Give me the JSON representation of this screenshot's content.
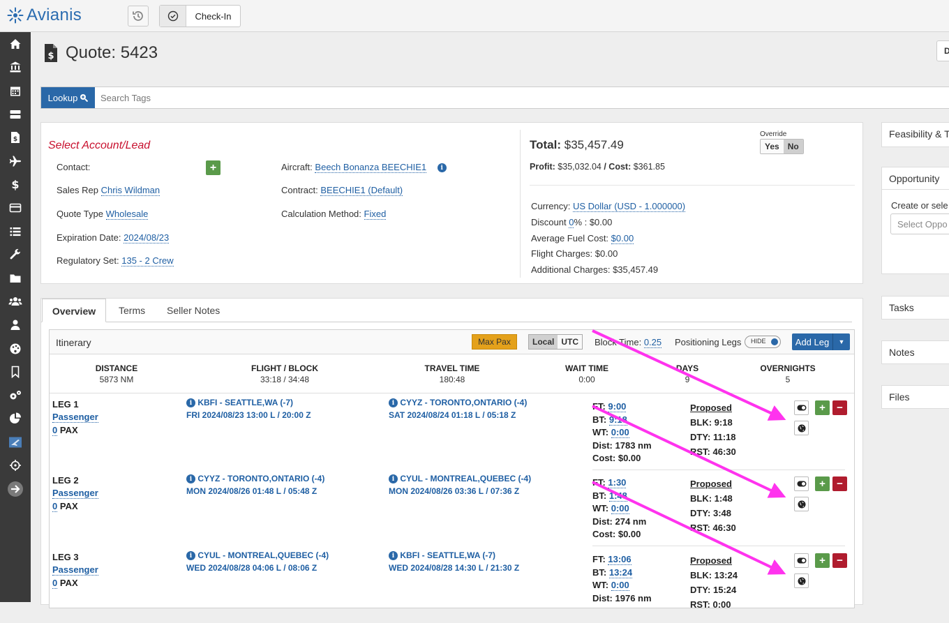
{
  "app": {
    "name": "Avianis",
    "checkin_label": "Check-In"
  },
  "page": {
    "title": "Quote: 5423",
    "top_right_btn": "D"
  },
  "lookup": {
    "button_label": "Lookup",
    "placeholder": "Search Tags"
  },
  "quote": {
    "select_account": "Select Account/Lead",
    "contact_label": "Contact:",
    "sales_rep_label": "Sales Rep",
    "sales_rep": "Chris Wildman",
    "quote_type_label": "Quote Type",
    "quote_type": "Wholesale",
    "expiration_label": "Expiration Date:",
    "expiration": "2024/08/23",
    "regulatory_label": "Regulatory Set:",
    "regulatory": "135 - 2 Crew",
    "aircraft_label": "Aircraft:",
    "aircraft": "Beech Bonanza BEECHIE1",
    "contract_label": "Contract:",
    "contract": "BEECHIE1 (Default)",
    "calc_label": "Calculation Method:",
    "calc": "Fixed"
  },
  "totals": {
    "total_label": "Total:",
    "total": "$35,457.49",
    "profit_label": "Profit:",
    "profit": "$35,032.04",
    "cost_label": "/ Cost:",
    "cost": "$361.85",
    "override_label": "Override",
    "override_yes": "Yes",
    "override_no": "No",
    "currency_label": "Currency:",
    "currency": "US Dollar (USD - 1.000000)",
    "discount_label": "Discount",
    "discount_pct": "0",
    "discount_rest": "% : $0.00",
    "fuel_label": "Average Fuel Cost:",
    "fuel": "$0.00",
    "flight_charges": "Flight Charges: $0.00",
    "additional_charges": "Additional Charges: $35,457.49"
  },
  "side_panels": {
    "feasibility": "Feasibility & T",
    "opportunity": "Opportunity",
    "opportunity_create": "Create or sele",
    "opportunity_placeholder": "Select Oppo",
    "tasks": "Tasks",
    "notes": "Notes",
    "files": "Files"
  },
  "tabs": [
    "Overview",
    "Terms",
    "Seller Notes"
  ],
  "itinerary": {
    "title": "Itinerary",
    "max_pax": "Max Pax",
    "local": "Local",
    "utc": "UTC",
    "block_time_label": "Block Time:",
    "block_time": "0.25",
    "positioning_label": "Positioning Legs",
    "hide": "HIDE",
    "add_leg": "Add Leg",
    "stats": [
      {
        "key": "DISTANCE",
        "value": "5873 NM"
      },
      {
        "key": "FLIGHT / BLOCK",
        "value": "33:18 / 34:48"
      },
      {
        "key": "TRAVEL TIME",
        "value": "180:48"
      },
      {
        "key": "WAIT TIME",
        "value": "0:00"
      },
      {
        "key": "DAYS",
        "value": "9"
      },
      {
        "key": "OVERNIGHTS",
        "value": "5"
      }
    ],
    "legs": [
      {
        "label": "LEG 1",
        "type": "Passenger",
        "pax_count": "0",
        "pax_label": "PAX",
        "dep_airport": "KBFI - SEATTLE,WA (-7)",
        "dep_time": "FRI 2024/08/23 13:00 L / 20:00 Z",
        "arr_airport": "CYYZ - TORONTO,ONTARIO (-4)",
        "arr_time": "SAT 2024/08/24 01:18 L / 05:18 Z",
        "ft": "9:00",
        "bt": "9:18",
        "wt": "0:00",
        "dist": "1783 nm",
        "cost": "$0.00",
        "status": "Proposed",
        "blk": "9:18",
        "dty": "11:18",
        "rst": "46:30"
      },
      {
        "label": "LEG 2",
        "type": "Passenger",
        "pax_count": "0",
        "pax_label": "PAX",
        "dep_airport": "CYYZ - TORONTO,ONTARIO (-4)",
        "dep_time": "MON 2024/08/26 01:48 L / 05:48 Z",
        "arr_airport": "CYUL - MONTREAL,QUEBEC (-4)",
        "arr_time": "MON 2024/08/26 03:36 L / 07:36 Z",
        "ft": "1:30",
        "bt": "1:48",
        "wt": "0:00",
        "dist": "274 nm",
        "cost": "$0.00",
        "status": "Proposed",
        "blk": "1:48",
        "dty": "3:48",
        "rst": "46:30"
      },
      {
        "label": "LEG 3",
        "type": "Passenger",
        "pax_count": "0",
        "pax_label": "PAX",
        "dep_airport": "CYUL - MONTREAL,QUEBEC (-4)",
        "dep_time": "WED 2024/08/28 04:06 L / 08:06 Z",
        "arr_airport": "KBFI - SEATTLE,WA (-7)",
        "arr_time": "WED 2024/08/28 14:30 L / 21:30 Z",
        "ft": "13:06",
        "bt": "13:24",
        "wt": "0:00",
        "dist": "1976 nm",
        "cost": "",
        "status": "Proposed",
        "blk": "13:24",
        "dty": "15:24",
        "rst": "0:00"
      }
    ]
  },
  "colors": {
    "brand": "#2a68a8",
    "annotation": "#ff33ee",
    "danger": "#b01c2e",
    "success": "#5a9a4a",
    "warning": "#e4a11b"
  },
  "sidebar_icons": [
    "home-icon",
    "bank-icon",
    "calendar-icon",
    "server-icon",
    "quote-icon",
    "plane-icon",
    "dollar-icon",
    "card-icon",
    "list-icon",
    "wrench-icon",
    "folder-icon",
    "users-icon",
    "user-icon",
    "palette-icon",
    "bookmark-icon",
    "settings-icon",
    "pie-chart-icon",
    "flight-board-icon",
    "crosshair-icon",
    "arrow-right-icon"
  ]
}
